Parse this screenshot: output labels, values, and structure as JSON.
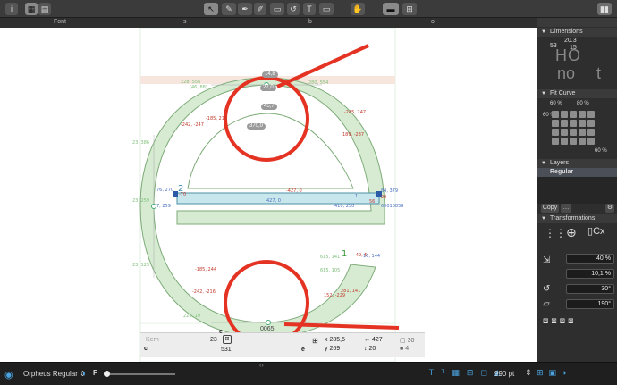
{
  "toolbar": {
    "info": "i",
    "view_a": "▦",
    "view_b": "▤",
    "tools": [
      "↖",
      "✎",
      "✒",
      "✐",
      "▭",
      "↺",
      "T",
      "▭",
      "✋",
      "▬",
      "⊞"
    ],
    "right": "▮▮"
  },
  "columns": {
    "font": "Font",
    "s": "s",
    "b": "b",
    "o": "o",
    "e": "e"
  },
  "canvas": {
    "labels_green": [
      "228, 556",
      "(46, 88)",
      "280, 554",
      "23, 386",
      "23, 259",
      "23, 125",
      "228, 19",
      "615, 105",
      "615, 141",
      "1",
      "2"
    ],
    "labels_red": [
      "-245, 247",
      "-185, 215",
      "-242, -247",
      "189, -237",
      "-427, 0",
      "56",
      "-49, 5",
      "-185, 244",
      "-242, -216",
      "152, -229",
      "281, 141"
    ],
    "labels_blue": [
      "427, 0",
      "410, 250",
      "76, 270",
      "7, 259",
      "-70",
      "1",
      "84, 379",
      "20",
      "60010859",
      "16, 144"
    ],
    "pills": [
      "14,8",
      "27,0",
      "45,7",
      "370,0"
    ],
    "glyph_code": "0065"
  },
  "glyph_info": {
    "kern": "Kern",
    "glyph_left": "e",
    "glyph_right": "c",
    "glyph_e": "e",
    "lsb": "23",
    "advance": "531",
    "x": "285,5",
    "y": "269",
    "w": "427",
    "h": "20",
    "count_a": "30",
    "count_b": "4"
  },
  "sidebar": {
    "dimensions": "Dimensions",
    "dim_a": "53",
    "dim_b": "20.3",
    "dim_c": "15",
    "preview_a": "HO",
    "preview_b": "no",
    "preview_c": "t",
    "fit_curve": "Fit Curve",
    "fit_a": "60 %",
    "fit_b": "80 %",
    "fit_c": "60 %",
    "fit_d": "60 %",
    "layers": "Layers",
    "layer_regular": "Regular",
    "copy": "Copy",
    "transformations": "Transformations",
    "cx": "Cx",
    "scale": "40 %",
    "scale2": "10,1 %",
    "rotate": "30°",
    "slant": "190°"
  },
  "statusbar": {
    "font_name": "Orpheus Regular",
    "master_icon": "F",
    "zoom": "990 pt",
    "center": "‹›"
  },
  "colors": {
    "green_fill": "#d6ebd2",
    "red": "#e43323",
    "selection": "#c8e7ec"
  }
}
